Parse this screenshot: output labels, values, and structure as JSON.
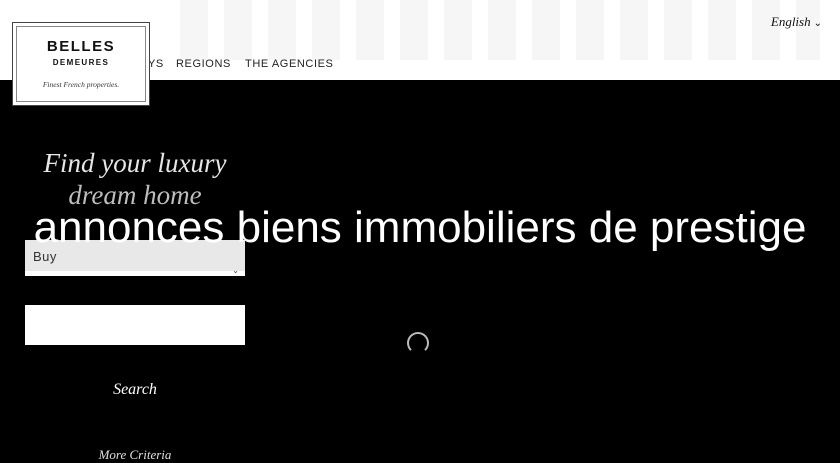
{
  "header": {
    "logo": {
      "line1": "BELLES",
      "line2": "DEMEURES",
      "tagline": "Finest French properties."
    },
    "nav": {
      "partial_item": "YS",
      "regions": "REGIONS",
      "agencies": "THE AGENCIES"
    },
    "language": {
      "label": "English",
      "chevron": "⌄"
    }
  },
  "hero": {
    "title_line1": "Find your luxury",
    "title_line2": "dream home",
    "overlay_text": "annonces biens immobiliers de prestige"
  },
  "search_form": {
    "transaction_select": {
      "value": "Buy",
      "arrow": "⌄"
    },
    "location_field": {
      "value": ""
    },
    "search_label": "Search",
    "more_criteria_label": "More Criteria"
  }
}
